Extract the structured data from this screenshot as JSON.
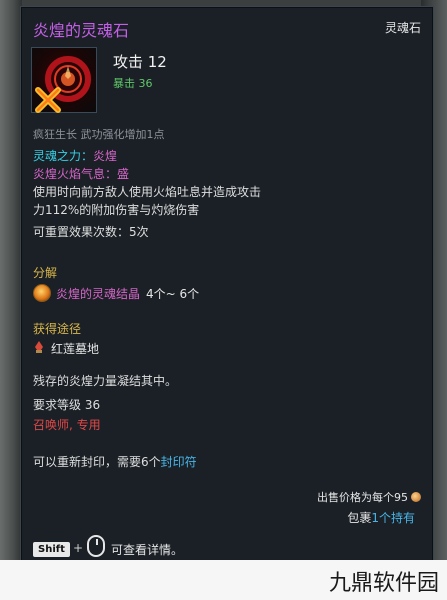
{
  "tooltip": {
    "title": "炎煌的灵魂石",
    "type_label": "灵魂石",
    "icon": "soul-stone-red-icon",
    "attack": "攻击 12",
    "crit": "暴击 36",
    "passive": "疯狂生长 武功强化增加1点",
    "soul_power_label": "灵魂之力：",
    "soul_power_value": "炎煌",
    "soul_breath_label": "炎煌火焰气息：",
    "soul_breath_value": "盛",
    "desc_line1": "使用时向前方敌人使用火焰吐息并造成攻击",
    "desc_line2": "力112%的附加伤害与灼烧伤害",
    "reset_count": "可重置效果次数：5次",
    "decompose_header": "分解",
    "decompose_item": "炎煌的灵魂结晶",
    "decompose_qty": "4个~ 6个",
    "obtain_header": "获得途径",
    "obtain_location": "红莲墓地",
    "lore": "残存的炎煌力量凝结其中。",
    "required_level": "要求等级 36",
    "class_restrict": "召唤师, 专用",
    "reseal_prefix": "可以重新封印，需要6个",
    "reseal_item": "封印符",
    "sell_label": "出售价格为每个95",
    "bag_prefix": "包裹",
    "bag_count": "1个持有",
    "shift_key": "Shift",
    "plus": "+",
    "view_details": "可查看详情。"
  },
  "footer": {
    "watermark": "九鼎软件园"
  },
  "colors": {
    "title": "#c460e8",
    "cyan": "#37d0e6",
    "pink": "#d665c8",
    "gold": "#d8b64a",
    "red": "#e04848",
    "blue": "#48b5e8",
    "green": "#5fc86a"
  }
}
